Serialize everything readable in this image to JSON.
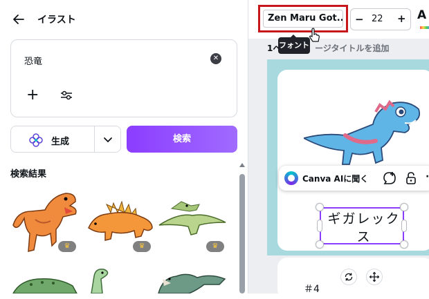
{
  "panel": {
    "title": "イラスト",
    "search_query": "恐竜",
    "generate_label": "生成",
    "search_label": "検索",
    "results_title": "検索結果"
  },
  "toolbar": {
    "font_name": "Zen Maru Got...",
    "font_size": "22",
    "size_minus": "−",
    "size_plus": "+",
    "text_color_glyph": "A",
    "tooltip": "フォント"
  },
  "page": {
    "label_prefix": "1ペ",
    "label_suffix": "ージタイトルを追加"
  },
  "ai_bar": {
    "label": "Canva AIに聞く"
  },
  "textbox": {
    "text": "ギガレックス"
  },
  "page2": {
    "text": "＃4"
  },
  "colors": {
    "accent": "#8b3dff",
    "highlight": "#c8161d",
    "canvas_bg": "#a7d9df"
  }
}
